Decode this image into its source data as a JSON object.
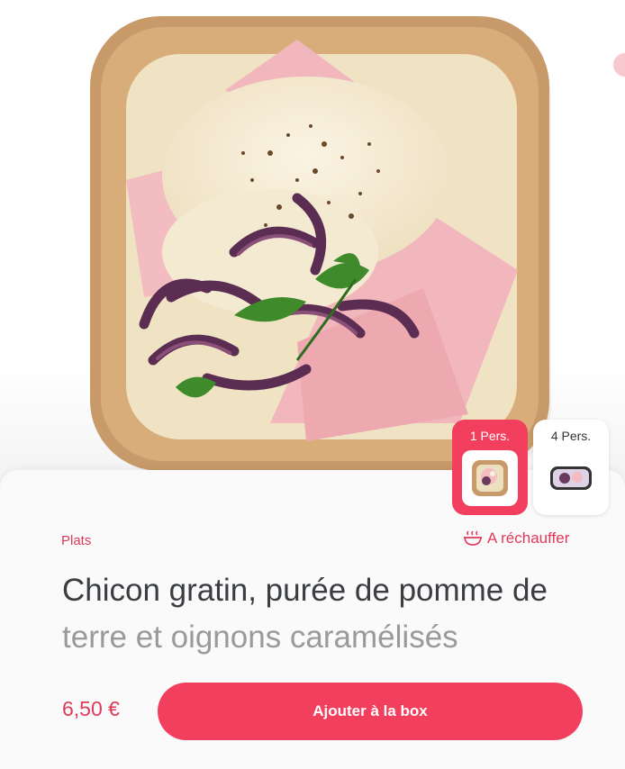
{
  "product": {
    "category": "Plats",
    "reheat_label": "A réchauffer",
    "title_line1": "Chicon gratin, purée de pomme de",
    "title_line2": "terre et oignons caramélisés",
    "price": "6,50 €",
    "add_button": "Ajouter à la box"
  },
  "variants": [
    {
      "label": "1 Pers.",
      "selected": true
    },
    {
      "label": "4 Pers.",
      "selected": false
    }
  ],
  "colors": {
    "accent": "#f23f5d",
    "accent_text": "#e03a59",
    "title": "#3a3d42",
    "card_bg": "#fafafa"
  },
  "icons": {
    "reheat": "steaming-bowl-icon"
  }
}
